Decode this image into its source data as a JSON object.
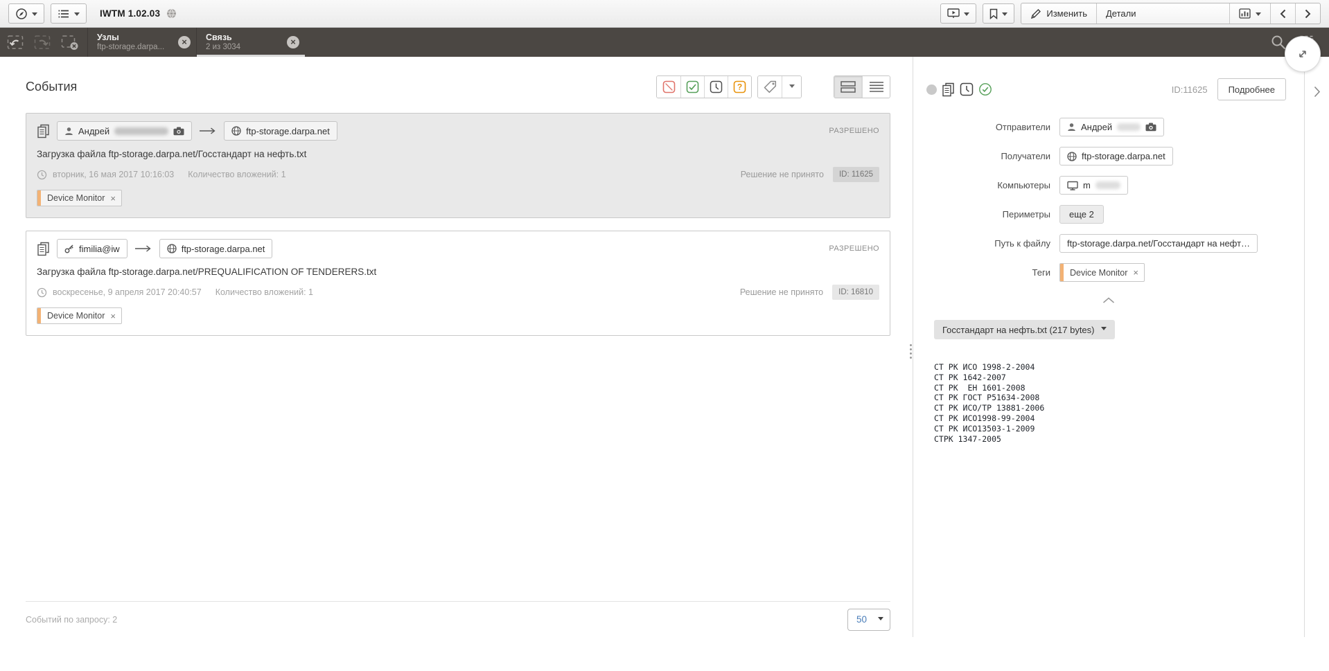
{
  "app": {
    "title": "IWTM 1.02.03"
  },
  "toolbar": {
    "edit": "Изменить",
    "details": "Детали"
  },
  "tabs": [
    {
      "title": "Узлы",
      "subtitle": "ftp-storage.darpa...",
      "active": false
    },
    {
      "title": "Связь",
      "subtitle": "2 из 3034",
      "active": true
    }
  ],
  "events": {
    "heading": "События",
    "list": [
      {
        "sender": "Андрей",
        "recipient": "ftp-storage.darpa.net",
        "title": "Загрузка файла ftp-storage.darpa.net/Госстандарт на нефть.txt",
        "datetime": "вторник, 16 мая 2017 10:16:03",
        "attachments": "Количество вложений: 1",
        "verdict": "РАЗРЕШЕНО",
        "decision": "Решение не принято",
        "id": "ID: 11625",
        "tag": "Device Monitor"
      },
      {
        "sender": "fimilia@iw",
        "recipient": "ftp-storage.darpa.net",
        "title": "Загрузка файла ftp-storage.darpa.net/PREQUALIFICATION OF TENDERERS.txt",
        "datetime": "воскресенье, 9 апреля 2017 20:40:57",
        "attachments": "Количество вложений: 1",
        "verdict": "РАЗРЕШЕНО",
        "decision": "Решение не принято",
        "id": "ID: 16810",
        "tag": "Device Monitor"
      }
    ],
    "footer": {
      "count": "Событий по запросу: 2",
      "page_size": "50"
    }
  },
  "details": {
    "id": "ID:11625",
    "more": "Подробнее",
    "fields": {
      "senders_label": "Отправители",
      "senders_value": "Андрей",
      "recipients_label": "Получатели",
      "recipients_value": "ftp-storage.darpa.net",
      "computers_label": "Компьютеры",
      "computers_value": "m",
      "perimeters_label": "Периметры",
      "perimeters_value": "еще 2",
      "path_label": "Путь к файлу",
      "path_value": "ftp-storage.darpa.net/Госстандарт на нефт…",
      "tags_label": "Теги",
      "tags_value": "Device Monitor"
    },
    "attachment": "Госстандарт на нефть.txt (217 bytes)",
    "file_text": "СТ РК ИСО 1998-2-2004\nСТ РК 1642-2007\nСТ РК  ЕН 1601-2008\nСТ РК ГОСТ Р51634-2008\nСТ РК ИСО/ТР 13881-2006\nСТ РК ИСО1998-99-2004\nСТ РК ИСО13503-1-2009\nСТРК 1347-2005"
  },
  "colors": {
    "tabbar_bg": "#4b4743",
    "accent_orange": "#f3b274",
    "status_green": "#57a05a",
    "status_red": "#e0736a",
    "status_question_orange": "#e8930c",
    "link_blue": "#4a7db9"
  },
  "icons": {
    "compass-icon": "circle+needle",
    "list-icon": "≡",
    "globe-status-icon": "gray sphere",
    "presentation-icon": "screen+play",
    "bookmark-icon": "ribbon",
    "pencil-icon": "✎",
    "chart-icon": "bars",
    "chevron-left-icon": "‹",
    "chevron-right-icon": "›",
    "undo-selection-icon": "↶ in dashed box",
    "redo-selection-icon": "↷ in dashed box",
    "clear-selection-icon": "dashed box + ⊗",
    "search-icon": "magnifier",
    "select-area-icon": "dashed box + cursor",
    "copy-icon": "two pages",
    "person-icon": "silhouette",
    "camera-icon": "camera",
    "globe-host-icon": "globe",
    "arrow-right-icon": "→",
    "clock-icon": "◷",
    "key-icon": "key",
    "monitor-icon": "display",
    "tag-icon": "label",
    "blocked-filter-icon": "red slash box",
    "allowed-filter-icon": "green check box",
    "pending-filter-icon": "clock box",
    "question-filter-icon": "orange ? box",
    "cards-view-icon": "stacked rows",
    "list-view-icon": "lines",
    "chevron-up-icon": "⌃",
    "close-icon": "×",
    "expand-icon": "double diagonal arrow"
  }
}
